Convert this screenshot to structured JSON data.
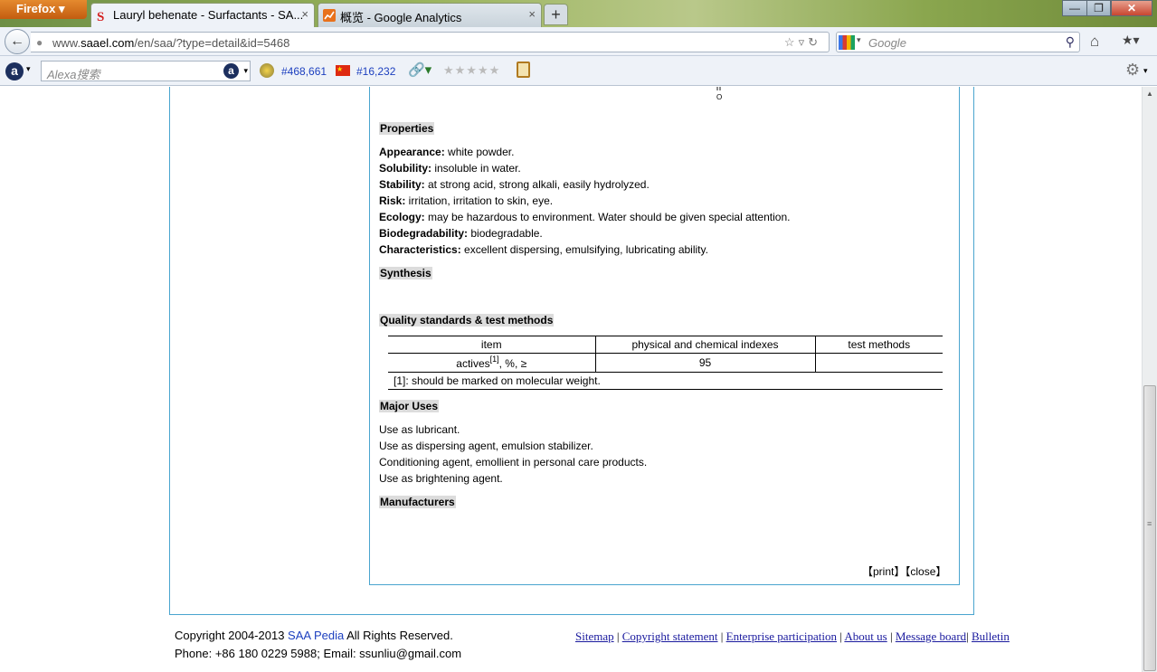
{
  "browser": {
    "app_button": "Firefox",
    "tabs": [
      {
        "label": "Lauryl behenate - Surfactants - SA..."
      },
      {
        "label": "概览 - Google Analytics"
      }
    ],
    "url_prefix": "www.",
    "url_domain": "saael.com",
    "url_path": "/en/saa/?type=detail&id=5468",
    "search_placeholder": "Google"
  },
  "alexa": {
    "search_placeholder": "Alexa搜索",
    "global_rank": "#468,661",
    "country_rank": "#16,232"
  },
  "content": {
    "sections": {
      "properties": "Properties",
      "synthesis": "Synthesis",
      "quality": "Quality standards & test methods",
      "uses": "Major Uses",
      "manufacturers": "Manufacturers"
    },
    "properties": [
      {
        "key": "Appearance:",
        "value": " white powder."
      },
      {
        "key": "Solubility:",
        "value": " insoluble in water."
      },
      {
        "key": "Stability:",
        "value": " at strong acid, strong alkali, easily hydrolyzed."
      },
      {
        "key": "Risk:",
        "value": " irritation, irritation to skin, eye."
      },
      {
        "key": "Ecology:",
        "value": " may be hazardous to environment. Water should be given special attention."
      },
      {
        "key": "Biodegradability:",
        "value": " biodegradable."
      },
      {
        "key": "Characteristics:",
        "value": " excellent dispersing, emulsifying, lubricating ability."
      }
    ],
    "table": {
      "headers": [
        "item",
        "physical and chemical indexes",
        "test methods"
      ],
      "row_item": "actives",
      "row_item_sup": "[1]",
      "row_item_suffix": ", %, ≥",
      "row_value": "95",
      "row_method": "",
      "note": "[1]: should be marked on molecular weight."
    },
    "uses": [
      "Use as lubricant.",
      "Use as dispersing agent, emulsion stabilizer.",
      "Conditioning agent, emollient in personal care products.",
      "Use as brightening agent."
    ],
    "print_label": "【print】",
    "close_label": "【close】",
    "molecule_o": "O"
  },
  "footer": {
    "copyright_prefix": "Copyright 2004-2013 ",
    "copyright_link": "SAA Pedia",
    "copyright_suffix": " All Rights Reserved.",
    "contact": "Phone: +86 180 0229 5988; Email: ssunliu@gmail.com",
    "links": [
      "Sitemap",
      "Copyright statement",
      "Enterprise participation",
      "About us",
      "Message board",
      "Bulletin"
    ]
  }
}
